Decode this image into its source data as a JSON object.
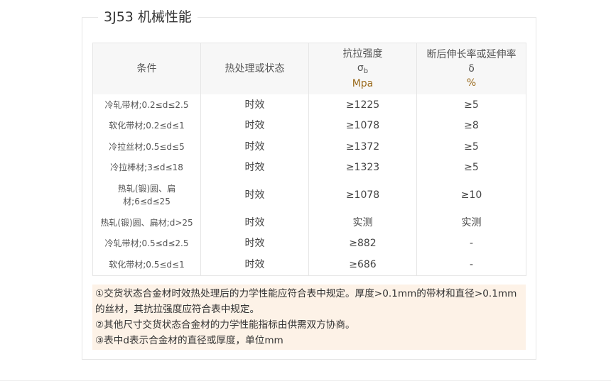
{
  "title": "3J53 机械性能",
  "table": {
    "headers": {
      "condition": "条件",
      "treatment": "热处理或状态",
      "strength": {
        "label": "抗拉强度",
        "symbol": "σ",
        "sub": "b",
        "unit": "Mpa"
      },
      "elongation": {
        "label": "断后伸长率或延伸率",
        "symbol": "δ",
        "unit": "%"
      }
    },
    "rows": [
      {
        "condition": "冷轧带材;0.2≤d≤2.5",
        "treatment": "时效",
        "strength": "≥1225",
        "elongation": "≥5"
      },
      {
        "condition": "软化带材;0.2≤d≤1",
        "treatment": "时效",
        "strength": "≥1078",
        "elongation": "≥8"
      },
      {
        "condition": "冷拉丝材;0.5≤d≤5",
        "treatment": "时效",
        "strength": "≥1372",
        "elongation": "≥5"
      },
      {
        "condition": "冷拉棒材;3≤d≤18",
        "treatment": "时效",
        "strength": "≥1323",
        "elongation": "≥5"
      },
      {
        "condition_line1": "热轧(锻)圆、扁",
        "condition_line2": "材;6≤d≤25",
        "treatment": "时效",
        "strength": "≥1078",
        "elongation": "≥10"
      },
      {
        "condition": "热轧(锻)圆、扁材;d>25",
        "treatment": "时效",
        "strength": "实测",
        "elongation": "实测"
      },
      {
        "condition": "冷轧带材;0.5≤d≤2.5",
        "treatment": "时效",
        "strength": "≥882",
        "elongation": "-"
      },
      {
        "condition": "软化带材;0.5≤d≤1",
        "treatment": "时效",
        "strength": "≥686",
        "elongation": "-"
      }
    ]
  },
  "notes": [
    "①交货状态合金材时效热处理后的力学性能应符合表中规定。厚度>0.1mm的带材和直径>0.1mm的丝材，其抗拉强度应符合表中规定。",
    "②其他尺寸交货状态合金材的力学性能指标由供需双方协商。",
    "③表中d表示合金材的直径或厚度，单位mm"
  ]
}
